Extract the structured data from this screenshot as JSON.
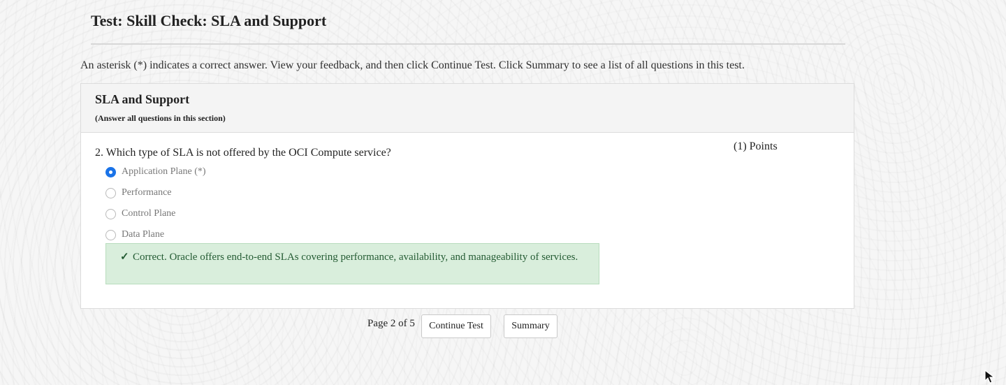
{
  "page": {
    "title": "Test: Skill Check: SLA and Support",
    "instruction": "An asterisk (*) indicates a correct answer. View your feedback, and then click Continue Test. Click Summary to see a list of all questions in this test."
  },
  "section": {
    "title": "SLA and Support",
    "subtitle": "(Answer all questions in this section)"
  },
  "question": {
    "text": "2. Which type of SLA is not offered by the OCI Compute service?",
    "points": "(1) Points",
    "options": [
      {
        "label": "Application Plane (*)",
        "selected": true
      },
      {
        "label": "Performance",
        "selected": false
      },
      {
        "label": "Control Plane",
        "selected": false
      },
      {
        "label": "Data Plane",
        "selected": false
      }
    ],
    "feedback": "Correct. Oracle offers end-to-end SLAs covering performance, availability, and manageability of services."
  },
  "pagination": {
    "label": "Page 2 of 5"
  },
  "buttons": {
    "continue": "Continue Test",
    "summary": "Summary"
  },
  "icons": {
    "selected": "radio-selected-icon",
    "unselected": "radio-unselected-icon",
    "correct": "check-icon",
    "cursor": "mouse-pointer-icon"
  },
  "colors": {
    "accent": "#1a73e8",
    "success_bg": "#d9eedc",
    "success_text": "#245b33"
  }
}
